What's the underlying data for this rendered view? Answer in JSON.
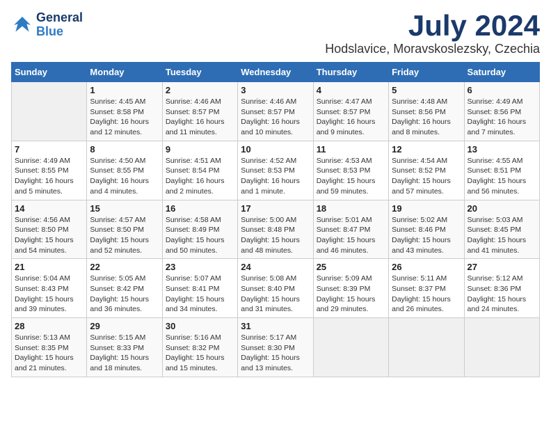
{
  "logo": {
    "line1": "General",
    "line2": "Blue"
  },
  "title": "July 2024",
  "location": "Hodslavice, Moravskoslezsky, Czechia",
  "days_of_week": [
    "Sunday",
    "Monday",
    "Tuesday",
    "Wednesday",
    "Thursday",
    "Friday",
    "Saturday"
  ],
  "weeks": [
    [
      {
        "num": "",
        "info": ""
      },
      {
        "num": "1",
        "info": "Sunrise: 4:45 AM\nSunset: 8:58 PM\nDaylight: 16 hours\nand 12 minutes."
      },
      {
        "num": "2",
        "info": "Sunrise: 4:46 AM\nSunset: 8:57 PM\nDaylight: 16 hours\nand 11 minutes."
      },
      {
        "num": "3",
        "info": "Sunrise: 4:46 AM\nSunset: 8:57 PM\nDaylight: 16 hours\nand 10 minutes."
      },
      {
        "num": "4",
        "info": "Sunrise: 4:47 AM\nSunset: 8:57 PM\nDaylight: 16 hours\nand 9 minutes."
      },
      {
        "num": "5",
        "info": "Sunrise: 4:48 AM\nSunset: 8:56 PM\nDaylight: 16 hours\nand 8 minutes."
      },
      {
        "num": "6",
        "info": "Sunrise: 4:49 AM\nSunset: 8:56 PM\nDaylight: 16 hours\nand 7 minutes."
      }
    ],
    [
      {
        "num": "7",
        "info": "Sunrise: 4:49 AM\nSunset: 8:55 PM\nDaylight: 16 hours\nand 5 minutes."
      },
      {
        "num": "8",
        "info": "Sunrise: 4:50 AM\nSunset: 8:55 PM\nDaylight: 16 hours\nand 4 minutes."
      },
      {
        "num": "9",
        "info": "Sunrise: 4:51 AM\nSunset: 8:54 PM\nDaylight: 16 hours\nand 2 minutes."
      },
      {
        "num": "10",
        "info": "Sunrise: 4:52 AM\nSunset: 8:53 PM\nDaylight: 16 hours\nand 1 minute."
      },
      {
        "num": "11",
        "info": "Sunrise: 4:53 AM\nSunset: 8:53 PM\nDaylight: 15 hours\nand 59 minutes."
      },
      {
        "num": "12",
        "info": "Sunrise: 4:54 AM\nSunset: 8:52 PM\nDaylight: 15 hours\nand 57 minutes."
      },
      {
        "num": "13",
        "info": "Sunrise: 4:55 AM\nSunset: 8:51 PM\nDaylight: 15 hours\nand 56 minutes."
      }
    ],
    [
      {
        "num": "14",
        "info": "Sunrise: 4:56 AM\nSunset: 8:50 PM\nDaylight: 15 hours\nand 54 minutes."
      },
      {
        "num": "15",
        "info": "Sunrise: 4:57 AM\nSunset: 8:50 PM\nDaylight: 15 hours\nand 52 minutes."
      },
      {
        "num": "16",
        "info": "Sunrise: 4:58 AM\nSunset: 8:49 PM\nDaylight: 15 hours\nand 50 minutes."
      },
      {
        "num": "17",
        "info": "Sunrise: 5:00 AM\nSunset: 8:48 PM\nDaylight: 15 hours\nand 48 minutes."
      },
      {
        "num": "18",
        "info": "Sunrise: 5:01 AM\nSunset: 8:47 PM\nDaylight: 15 hours\nand 46 minutes."
      },
      {
        "num": "19",
        "info": "Sunrise: 5:02 AM\nSunset: 8:46 PM\nDaylight: 15 hours\nand 43 minutes."
      },
      {
        "num": "20",
        "info": "Sunrise: 5:03 AM\nSunset: 8:45 PM\nDaylight: 15 hours\nand 41 minutes."
      }
    ],
    [
      {
        "num": "21",
        "info": "Sunrise: 5:04 AM\nSunset: 8:43 PM\nDaylight: 15 hours\nand 39 minutes."
      },
      {
        "num": "22",
        "info": "Sunrise: 5:05 AM\nSunset: 8:42 PM\nDaylight: 15 hours\nand 36 minutes."
      },
      {
        "num": "23",
        "info": "Sunrise: 5:07 AM\nSunset: 8:41 PM\nDaylight: 15 hours\nand 34 minutes."
      },
      {
        "num": "24",
        "info": "Sunrise: 5:08 AM\nSunset: 8:40 PM\nDaylight: 15 hours\nand 31 minutes."
      },
      {
        "num": "25",
        "info": "Sunrise: 5:09 AM\nSunset: 8:39 PM\nDaylight: 15 hours\nand 29 minutes."
      },
      {
        "num": "26",
        "info": "Sunrise: 5:11 AM\nSunset: 8:37 PM\nDaylight: 15 hours\nand 26 minutes."
      },
      {
        "num": "27",
        "info": "Sunrise: 5:12 AM\nSunset: 8:36 PM\nDaylight: 15 hours\nand 24 minutes."
      }
    ],
    [
      {
        "num": "28",
        "info": "Sunrise: 5:13 AM\nSunset: 8:35 PM\nDaylight: 15 hours\nand 21 minutes."
      },
      {
        "num": "29",
        "info": "Sunrise: 5:15 AM\nSunset: 8:33 PM\nDaylight: 15 hours\nand 18 minutes."
      },
      {
        "num": "30",
        "info": "Sunrise: 5:16 AM\nSunset: 8:32 PM\nDaylight: 15 hours\nand 15 minutes."
      },
      {
        "num": "31",
        "info": "Sunrise: 5:17 AM\nSunset: 8:30 PM\nDaylight: 15 hours\nand 13 minutes."
      },
      {
        "num": "",
        "info": ""
      },
      {
        "num": "",
        "info": ""
      },
      {
        "num": "",
        "info": ""
      }
    ]
  ]
}
